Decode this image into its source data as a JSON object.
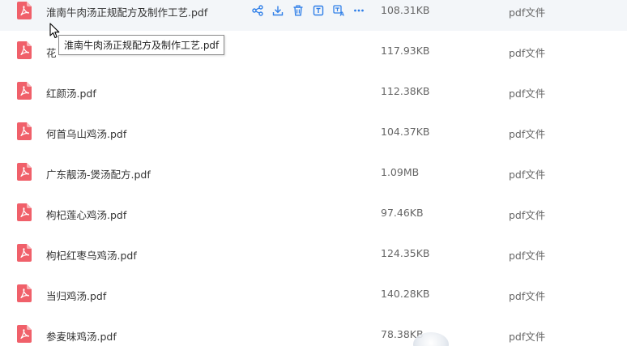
{
  "tooltip": "淮南牛肉汤正规配方及制作工艺.pdf",
  "actions": [
    {
      "icon": "share-icon",
      "name": "share-button"
    },
    {
      "icon": "download-icon",
      "name": "download-button"
    },
    {
      "icon": "delete-icon",
      "name": "delete-button"
    },
    {
      "icon": "text-extract-icon",
      "name": "text-extract-button"
    },
    {
      "icon": "translate-icon",
      "name": "translate-button"
    },
    {
      "icon": "more-icon",
      "name": "more-button"
    }
  ],
  "colors": {
    "accent": "#2f7fe8",
    "pdf_red": "#f0606a",
    "hover_row": "#f3f6f9"
  },
  "files": [
    {
      "name": "淮南牛肉汤正规配方及制作工艺.pdf",
      "size": "108.31KB",
      "type": "pdf文件"
    },
    {
      "name": "花",
      "size": "117.93KB",
      "type": "pdf文件"
    },
    {
      "name": "红颜汤.pdf",
      "size": "112.38KB",
      "type": "pdf文件"
    },
    {
      "name": "何首乌山鸡汤.pdf",
      "size": "104.37KB",
      "type": "pdf文件"
    },
    {
      "name": "广东靓汤-煲汤配方.pdf",
      "size": "1.09MB",
      "type": "pdf文件"
    },
    {
      "name": "枸杞莲心鸡汤.pdf",
      "size": "97.46KB",
      "type": "pdf文件"
    },
    {
      "name": "枸杞红枣乌鸡汤.pdf",
      "size": "124.35KB",
      "type": "pdf文件"
    },
    {
      "name": "当归鸡汤.pdf",
      "size": "140.28KB",
      "type": "pdf文件"
    },
    {
      "name": "参麦味鸡汤.pdf",
      "size": "78.38KB",
      "type": "pdf文件"
    }
  ]
}
